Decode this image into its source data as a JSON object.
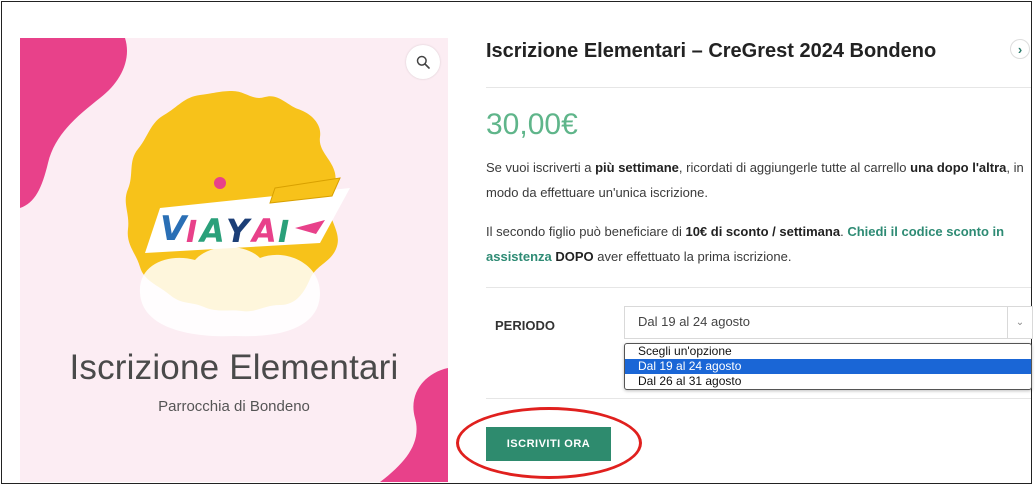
{
  "product": {
    "title": "Iscrizione Elementari – CreGrest 2024 Bondeno",
    "price": "30,00€",
    "image": {
      "logo_text": "VIAYAI",
      "title": "Iscrizione Elementari",
      "subtitle": "Parrocchia di Bondeno"
    }
  },
  "description": {
    "p1": [
      {
        "text": "Se vuoi iscriverti a ",
        "style": "normal"
      },
      {
        "text": "più settimane",
        "style": "bold"
      },
      {
        "text": ", ricordati di aggiungerle tutte al carrello ",
        "style": "normal"
      },
      {
        "text": "una dopo l'altra",
        "style": "bold"
      },
      {
        "text": ", in modo da effettuare un'unica iscrizione.",
        "style": "normal"
      }
    ],
    "p2": [
      {
        "text": "Il secondo figlio può beneficiare di ",
        "style": "normal"
      },
      {
        "text": "10€ di sconto / settimana",
        "style": "bold"
      },
      {
        "text": ". ",
        "style": "normal"
      },
      {
        "text": "Chiedi il codice sconto in assistenza",
        "style": "green"
      },
      {
        "text": " ",
        "style": "normal"
      },
      {
        "text": "DOPO",
        "style": "bold"
      },
      {
        "text": " aver effettuato la prima iscrizione.",
        "style": "normal"
      }
    ]
  },
  "variation": {
    "label": "PERIODO",
    "selected": "Dal 19 al 24 agosto",
    "options": [
      "Scegli un'opzione",
      "Dal 19 al 24 agosto",
      "Dal 26 al 31 agosto"
    ],
    "selected_index": 1
  },
  "cart": {
    "button_label": "ISCRIVITI ORA"
  },
  "colors": {
    "price": "#5fb58a",
    "button": "#2e8b6e",
    "link_green": "#2e8b74",
    "pink_blob": "#e8418a",
    "yellow_badge": "#f7c21a",
    "image_bg": "#fcedf3",
    "highlight_circle": "#e0201e"
  },
  "icons": {
    "zoom": "magnifier-icon",
    "next": "chevron-right-icon",
    "select": "chevron-down-icon"
  }
}
